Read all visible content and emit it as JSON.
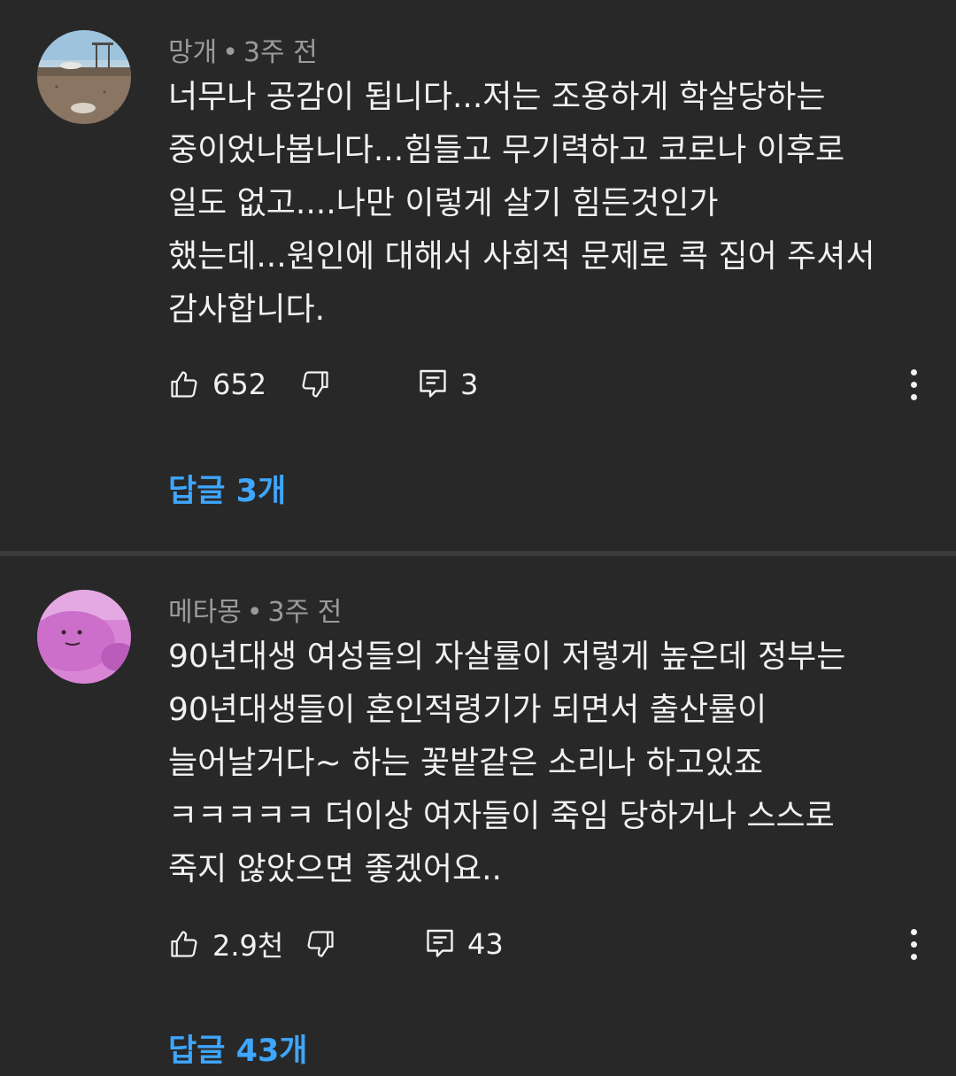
{
  "comments": [
    {
      "author": "망개",
      "separator": "•",
      "time": "3주 전",
      "lines": [
        "너무나 공감이 됩니다...저는 조용하게 학살당하는",
        "중이었나봅니다...힘들고 무기력하고 코로나 이후로",
        "일도 없고....나만 이렇게 살기 힘든것인가",
        "했는데...원인에 대해서 사회적 문제로 콕 집어 주셔서",
        "감사합니다."
      ],
      "likes": "652",
      "reply_count": "3",
      "replies_label": "답글 3개",
      "avatar_icon": "beach-photo-avatar"
    },
    {
      "author": "메타몽",
      "separator": "•",
      "time": "3주 전",
      "lines": [
        "90년대생 여성들의 자살률이 저렇게 높은데 정부는",
        "90년대생들이 혼인적령기가 되면서 출산률이",
        "늘어날거다~ 하는 꽃밭같은 소리나 하고있죠",
        "ㅋㅋㅋㅋㅋ 더이상 여자들이 죽임 당하거나 스스로",
        "죽지 않았으면 좋겠어요.."
      ],
      "likes": "2.9천",
      "reply_count": "43",
      "replies_label": "답글 43개",
      "avatar_icon": "ditto-pink-avatar"
    }
  ],
  "colors": {
    "background": "#282828",
    "text": "#f1f1f1",
    "meta": "#9b9b9b",
    "link": "#3ea6ff",
    "divider": "#3a3a3a"
  },
  "icons": [
    "thumbs-up-icon",
    "thumbs-down-icon",
    "reply-icon",
    "more-vertical-icon"
  ]
}
